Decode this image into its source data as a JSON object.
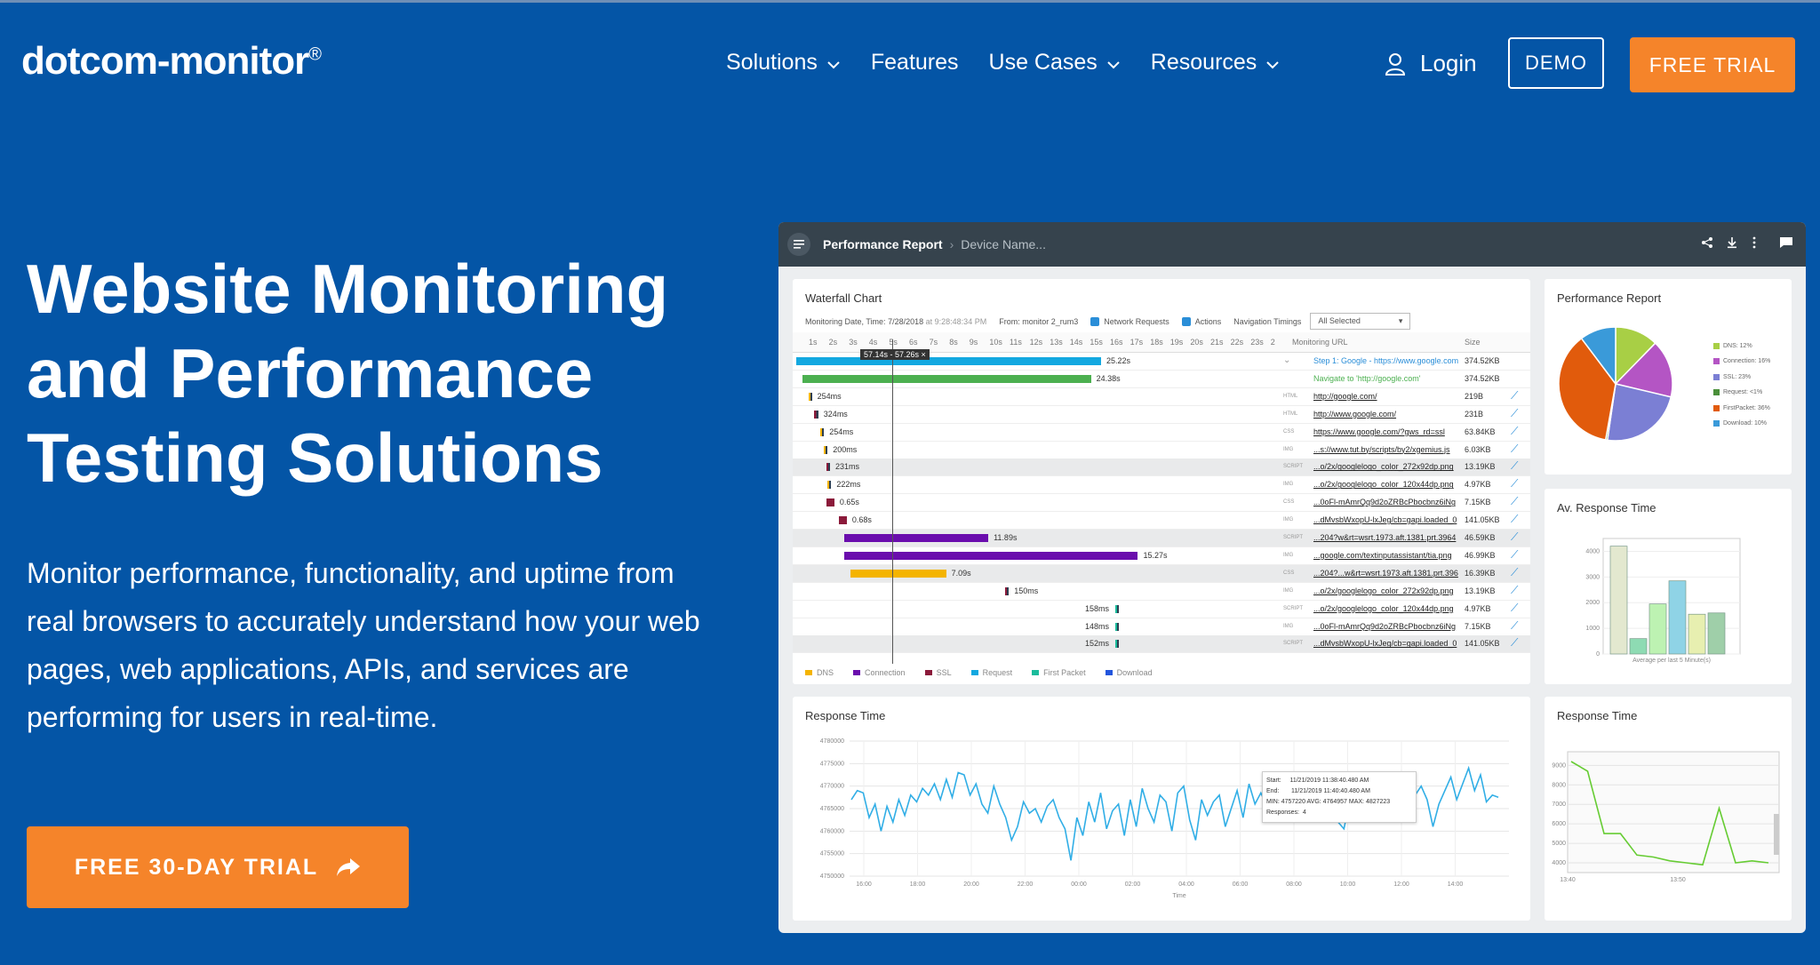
{
  "brand": {
    "name": "dotcom-monitor",
    "reg": "®"
  },
  "nav": {
    "items": [
      {
        "label": "Solutions",
        "has_dropdown": true
      },
      {
        "label": "Features",
        "has_dropdown": false
      },
      {
        "label": "Use Cases",
        "has_dropdown": true
      },
      {
        "label": "Resources",
        "has_dropdown": true
      }
    ],
    "login": "Login",
    "demo": "DEMO",
    "free_trial": "FREE TRIAL"
  },
  "hero": {
    "title": "Website Monitoring and Performance Testing Solutions",
    "subtitle": "Monitor performance, functionality, and uptime from real browsers to accurately understand how your web pages, web applications, APIs, and services are performing for users in real-time.",
    "cta": "FREE 30-DAY TRIAL"
  },
  "screenshot": {
    "breadcrumb": {
      "main": "Performance Report",
      "sub": "Device Name..."
    },
    "waterfall": {
      "title": "Waterfall Chart",
      "date_label": "Monitoring Date, Time:",
      "date": "7/28/2018",
      "at": "at",
      "time": "9:28:48:34 PM",
      "from_label": "From:",
      "from": "monitor 2_rum3",
      "network_requests": "Network Requests",
      "actions": "Actions",
      "nav_timings": "Navigation Timings",
      "nav_select": "All Selected",
      "ticks": [
        "1s",
        "2s",
        "3s",
        "4s",
        "5s",
        "6s",
        "7s",
        "8s",
        "9s",
        "10s",
        "11s",
        "12s",
        "13s",
        "14s",
        "15s",
        "16s",
        "17s",
        "18s",
        "19s",
        "20s",
        "21s",
        "22s",
        "23s",
        "2"
      ],
      "col_url": "Monitoring URL",
      "col_size": "Size",
      "cursor_label": "57.14s - 57.26s",
      "rows": [
        {
          "start": 0.0,
          "dur": 25.22,
          "label": "25.22s",
          "color": "#13a8e0",
          "type": "",
          "url": "Step 1: Google - https://www.google.com",
          "size": "374.52KB",
          "url_color": "#2a8ed8",
          "expand": true
        },
        {
          "start": 0.5,
          "dur": 23.88,
          "label": "24.38s",
          "color": "#4cb050",
          "type": "",
          "url": "Navigate to 'http://google.com'",
          "size": "374.52KB",
          "url_color": "#4cb050"
        },
        {
          "start": 1.0,
          "dur": 0.254,
          "label": "254ms",
          "color": "#f4b400",
          "type": "HTML",
          "url": "http://google.com/",
          "size": "219B"
        },
        {
          "start": 1.5,
          "dur": 0.324,
          "label": "324ms",
          "color": "#8b1a3a",
          "type": "HTML",
          "url": "http://www.google.com/",
          "size": "231B"
        },
        {
          "start": 2.0,
          "dur": 0.254,
          "label": "254ms",
          "color": "#f4b400",
          "type": "CSS",
          "url": "https://www.google.com/?gws_rd=ssl",
          "size": "63.84KB"
        },
        {
          "start": 2.3,
          "dur": 0.2,
          "label": "200ms",
          "color": "#f4b400",
          "type": "IMG",
          "url": "...s://www.tut.by/scripts/by2/xgemius.js",
          "size": "6.03KB"
        },
        {
          "start": 2.5,
          "dur": 0.231,
          "label": "231ms",
          "color": "#8b1a3a",
          "type": "SCRIPT",
          "url": "...o/2x/googlelogo_color_272x92dp.png",
          "size": "13.19KB",
          "alt": true
        },
        {
          "start": 2.6,
          "dur": 0.222,
          "label": "222ms",
          "color": "#f4b400",
          "type": "IMG",
          "url": "...o/2x/googlelogo_color_120x44dp.png",
          "size": "4.97KB"
        },
        {
          "start": 2.5,
          "dur": 0.65,
          "label": "0.65s",
          "color": "#8b1a3a",
          "type": "CSS",
          "url": "...0oFl-mAmrQq9d2oZRBcPbocbnz6iNg",
          "size": "7.15KB"
        },
        {
          "start": 3.5,
          "dur": 0.68,
          "label": "0.68s",
          "color": "#8b1a3a",
          "type": "IMG",
          "url": "...dMvsbWxopU-lxJeg/cb=gapi.loaded_0",
          "size": "141.05KB"
        },
        {
          "start": 4.0,
          "dur": 11.89,
          "label": "11.89s",
          "color": "#6a0dad",
          "type": "SCRIPT",
          "url": "...204?w&rt=wsrt.1973.aft.1381.prt.3964",
          "size": "46.59KB",
          "alt": true
        },
        {
          "start": 4.0,
          "dur": 24.27,
          "label": "15.27s",
          "color": "#6a0dad",
          "type": "IMG",
          "url": "...google.com/textinputassistant/tia.png",
          "size": "46.99KB"
        },
        {
          "start": 4.5,
          "dur": 7.9,
          "label": "7.09s",
          "color": "#f4b400",
          "type": "CSS",
          "url": "...204?...w&rt=wsrt.1973.aft.1381.prt.396",
          "size": "16.39KB",
          "alt": true
        },
        {
          "start": 17.3,
          "dur": 0.15,
          "label": "150ms",
          "color": "#8b1a3a",
          "type": "IMG",
          "url": "...o/2x/googlelogo_color_272x92dp.png",
          "size": "13.19KB"
        },
        {
          "start": 26.4,
          "dur": 0.158,
          "label": "158ms",
          "color": "#1abc9c",
          "type": "SCRIPT",
          "url": "...o/2x/googlelogo_color_120x44dp.png",
          "size": "4.97KB",
          "label_left": true
        },
        {
          "start": 26.4,
          "dur": 0.148,
          "label": "148ms",
          "color": "#1abc9c",
          "type": "IMG",
          "url": "...0oFl-mAmrQq9d2oZRBcPbocbnz6iNg",
          "size": "7.15KB",
          "label_left": true
        },
        {
          "start": 26.4,
          "dur": 0.152,
          "label": "152ms",
          "color": "#1abc9c",
          "type": "SCRIPT",
          "url": "...dMvsbWxopU-lxJeg/cb=gapi.loaded_0",
          "size": "141.05KB",
          "label_left": true,
          "alt": true
        }
      ],
      "legend": [
        {
          "label": "DNS",
          "color": "#f4b400"
        },
        {
          "label": "Connection",
          "color": "#6a0dad"
        },
        {
          "label": "SSL",
          "color": "#8b1a3a"
        },
        {
          "label": "Request",
          "color": "#13a8e0"
        },
        {
          "label": "First Packet",
          "color": "#1abc9c"
        },
        {
          "label": "Download",
          "color": "#2255dd"
        }
      ]
    },
    "pie": {
      "title": "Performance Report",
      "chart_data": {
        "type": "pie",
        "slices": [
          {
            "label": "DNS: 12%",
            "value": 12,
            "color": "#a8cf45"
          },
          {
            "label": "Connection: 16%",
            "value": 16,
            "color": "#b455c4"
          },
          {
            "label": "SSL: 23%",
            "value": 23,
            "color": "#7b7fd4"
          },
          {
            "label": "Request: <1%",
            "value": 0.5,
            "color": "#4a8f3a"
          },
          {
            "label": "FirstPacket: 36%",
            "value": 36,
            "color": "#e15b0c"
          },
          {
            "label": "Download: 10%",
            "value": 10,
            "color": "#3a9ad9"
          }
        ]
      }
    },
    "avg": {
      "title": "Av. Response Time",
      "chart_data": {
        "type": "bar",
        "xlabel": "Average per last 5 Minute(s)",
        "ylim": [
          0,
          4500
        ],
        "yticks": [
          "0",
          "1000",
          "2000",
          "3000",
          "4000"
        ],
        "values": [
          4200,
          600,
          1950,
          2850,
          1550,
          1600
        ],
        "colors": [
          "#e3e8cf",
          "#8edbb3",
          "#bdf2b2",
          "#8fd3e6",
          "#e7efb0",
          "#9fcfa9"
        ]
      }
    },
    "resp": {
      "title": "Response Time",
      "chart_data": {
        "type": "line",
        "color": "#31aee6",
        "yticks": [
          "4750000",
          "4755000",
          "4760000",
          "4765000",
          "4770000",
          "4775000",
          "4780000"
        ],
        "xticks": [
          "16:00",
          "18:00",
          "20:00",
          "22:00",
          "00:00",
          "02:00",
          "04:00",
          "06:00",
          "08:00",
          "10:00",
          "12:00",
          "14:00"
        ],
        "xlabel": "Time",
        "ylim": [
          4750000,
          4780000
        ],
        "values": [
          4767000,
          4769000,
          4768500,
          4763000,
          4766000,
          4760000,
          4765500,
          4762000,
          4767000,
          4763500,
          4768000,
          4766500,
          4769500,
          4768000,
          4770500,
          4767000,
          4771500,
          4767500,
          4773000,
          4772500,
          4768000,
          4770500,
          4766000,
          4764000,
          4770000,
          4766000,
          4763000,
          4758000,
          4761000,
          4766500,
          4764000,
          4765000,
          4762000,
          4765500,
          4767000,
          4763000,
          4760500,
          4753500,
          4763000,
          4759000,
          4766500,
          4762000,
          4768500,
          4760500,
          4764500,
          4766000,
          4759000,
          4767000,
          4761000,
          4769500,
          4765000,
          4762000,
          4768000,
          4766500,
          4760000,
          4768500,
          4770000,
          4762500,
          4758000,
          4767000,
          4763500,
          4766500,
          4768000,
          4761000,
          4765000,
          4769000,
          4763000,
          4770500,
          4766000,
          4768500,
          4765500,
          4770500,
          4769000,
          4767500,
          4771000,
          4768000,
          4772000,
          4767000,
          4765000,
          4769000,
          4766000,
          4770500,
          4762000,
          4760500,
          4767000,
          4764000,
          4769000,
          4766000,
          4770000,
          4768500,
          4765500,
          4771500,
          4769000,
          4770000,
          4769000,
          4768000,
          4770000,
          4767000,
          4761000,
          4766000,
          4769000,
          4772000,
          4767000,
          4770500,
          4774000,
          4769000,
          4772500,
          4766500,
          4768000,
          4767500
        ]
      },
      "tooltip": {
        "start_label": "Start:",
        "start": "11/21/2019 11:38:40.480 AM",
        "end_label": "End:",
        "end": "11/21/2019 11:40:40.480 AM",
        "stats": "MIN: 4757220  AVG: 4764957  MAX: 4827223",
        "responses_label": "Responses:",
        "responses": "4"
      }
    },
    "resp2": {
      "title": "Response Time",
      "chart_data": {
        "type": "line",
        "color": "#66cc33",
        "yticks": [
          "4000",
          "5000",
          "6000",
          "7000",
          "8000",
          "9000"
        ],
        "xticks": [
          "13:40",
          "13:50"
        ],
        "ylim": [
          3500,
          9700
        ],
        "values": [
          9200,
          8700,
          5500,
          5500,
          4400,
          4300,
          4100,
          4000,
          3900,
          6800,
          4000,
          4100,
          4000
        ]
      }
    }
  }
}
